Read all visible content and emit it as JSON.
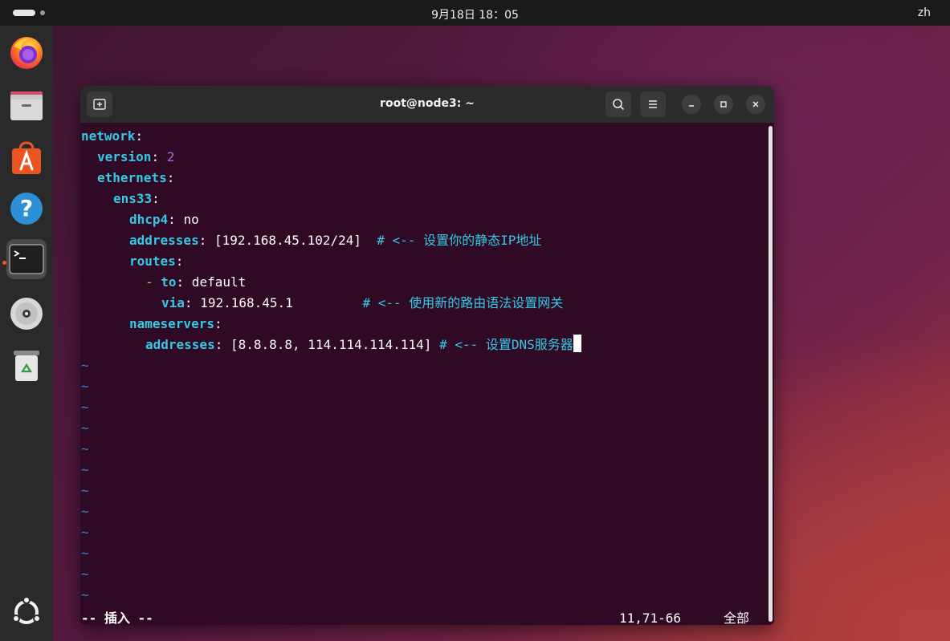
{
  "topbar": {
    "datetime": "9月18日  18：05",
    "lang": "zh"
  },
  "dock": {
    "items": [
      {
        "name": "firefox-icon"
      },
      {
        "name": "files-icon"
      },
      {
        "name": "app-center-icon"
      },
      {
        "name": "help-icon"
      },
      {
        "name": "terminal-icon",
        "active": true
      },
      {
        "name": "disc-icon"
      },
      {
        "name": "trash-icon"
      }
    ],
    "apps_icon": "ubuntu-logo-icon"
  },
  "window": {
    "title": "root@node3: ~",
    "colors": {
      "background": "#300a24",
      "key": "#34c9e6",
      "number": "#b964d6",
      "tilde": "#3f7fd6"
    }
  },
  "editor": {
    "lines": [
      {
        "key": "network",
        "rest": ""
      },
      {
        "key": "version",
        "num": "2"
      },
      {
        "key": "ethernets",
        "rest": ""
      },
      {
        "key": "ens33",
        "rest": ""
      },
      {
        "key": "dhcp4",
        "rest": " no"
      },
      {
        "key": "addresses",
        "rest": " [192.168.45.102/24]  ",
        "comment": "# <-- 设置你的静态IP地址"
      },
      {
        "key": "routes",
        "rest": ""
      },
      {
        "dash": "- ",
        "key": "to",
        "rest": " default"
      },
      {
        "key": "via",
        "rest": " 192.168.45.1         ",
        "comment": "# <-- 使用新的路由语法设置网关"
      },
      {
        "key": "nameservers",
        "rest": ""
      },
      {
        "key": "addresses",
        "rest": " [8.8.8.8, 114.114.114.114] ",
        "comment": "# <-- 设置DNS服务器"
      }
    ],
    "tilde": "~",
    "mode": "-- 插入 --",
    "position": "11,71-66",
    "scope": "全部"
  }
}
